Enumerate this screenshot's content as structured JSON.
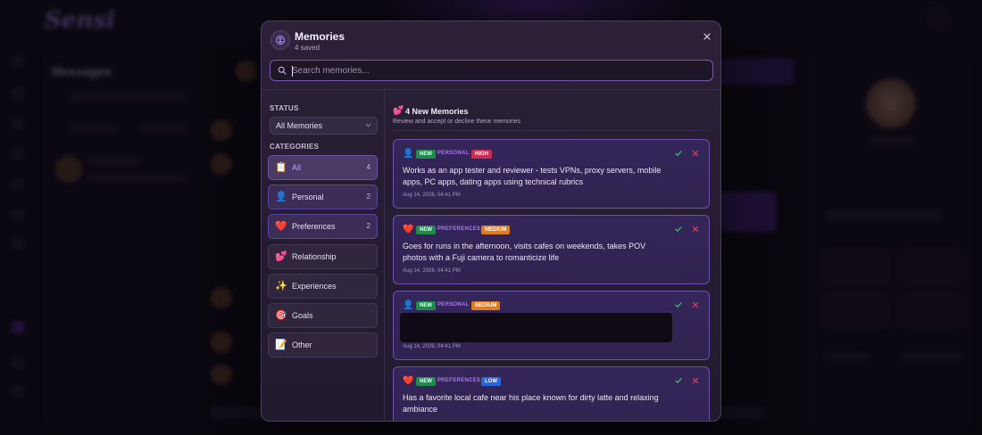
{
  "background": {
    "logo": "Sensi",
    "panel_title": "Messages"
  },
  "modal": {
    "title": "Memories",
    "subtitle": "4 saved"
  },
  "search": {
    "placeholder": "Search memories..."
  },
  "sidebar": {
    "status_label": "STATUS",
    "status_value": "All Memories",
    "categories_label": "CATEGORIES",
    "categories": [
      {
        "label": "All",
        "icon": "clipboard-icon",
        "glyph": "📋",
        "count": "4"
      },
      {
        "label": "Personal",
        "icon": "person-icon",
        "glyph": "👤",
        "count": "2"
      },
      {
        "label": "Preferences",
        "icon": "heart-icon",
        "glyph": "❤️",
        "count": "2"
      },
      {
        "label": "Relationship",
        "icon": "two-hearts-icon",
        "glyph": "💕",
        "count": ""
      },
      {
        "label": "Experiences",
        "icon": "sparkles-icon",
        "glyph": "✨",
        "count": ""
      },
      {
        "label": "Goals",
        "icon": "target-icon",
        "glyph": "🎯",
        "count": ""
      },
      {
        "label": "Other",
        "icon": "memo-icon",
        "glyph": "📝",
        "count": ""
      }
    ]
  },
  "main": {
    "header_glyph": "💕",
    "title": "4 New Memories",
    "subtitle": "Review and accept or decline these memories",
    "cards": [
      {
        "glyph": "👤",
        "new": "NEW",
        "category": "PERSONAL",
        "priority": "HIGH",
        "text": "Works as an app tester and reviewer - tests VPNs, proxy servers, mobile apps, PC apps, dating apps using technical rubrics",
        "date": "Aug 14, 2026, 04:41 PM"
      },
      {
        "glyph": "❤️",
        "new": "NEW",
        "category": "PREFERENCES",
        "priority": "MEDIUM",
        "text": "Goes for runs in the afternoon, visits cafes on weekends, takes POV photos with a Fuji camera to romanticize life",
        "date": "Aug 14, 2026, 04:41 PM"
      },
      {
        "glyph": "👤",
        "new": "NEW",
        "category": "PERSONAL",
        "priority": "MEDIUM",
        "text": "",
        "date": "Aug 14, 2026, 04:41 PM"
      },
      {
        "glyph": "❤️",
        "new": "NEW",
        "category": "PREFERENCES",
        "priority": "LOW",
        "text": "Has a favorite local cafe near his place known for dirty latte and relaxing ambiance",
        "date": ""
      }
    ]
  },
  "colors": {
    "accent": "#a979f2",
    "new_badge": "#1f8a4c",
    "high": "#c92d4f",
    "medium": "#e07b1f",
    "low": "#2b63d9",
    "accept": "#38c172",
    "decline": "#e0405e"
  }
}
